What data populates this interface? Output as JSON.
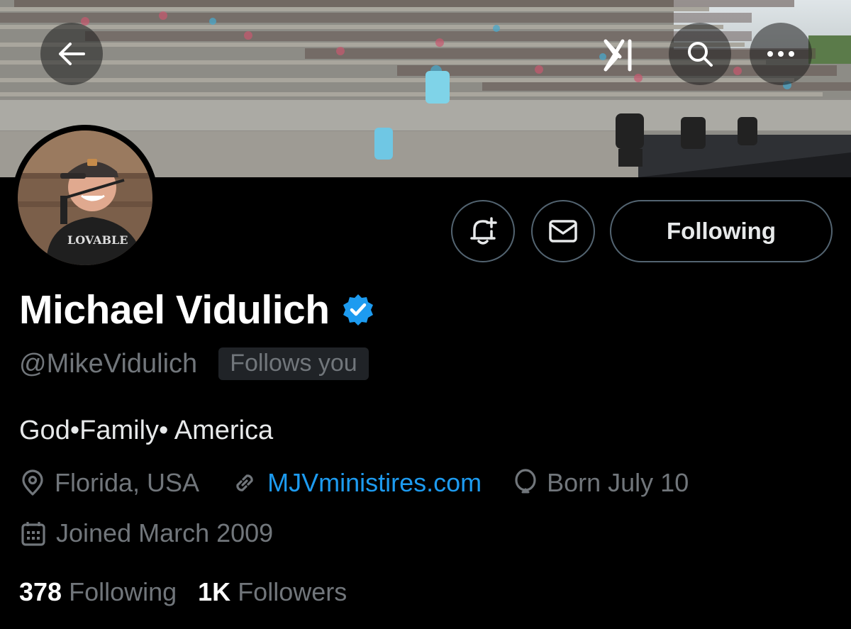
{
  "profile": {
    "display_name": "Michael Vidulich",
    "handle": "@MikeVidulich",
    "follows_you_badge": "Follows you",
    "bio": "God•Family• America",
    "location": "Florida, USA",
    "website": "MJVministires.com",
    "birthday": "Born July 10",
    "joined": "Joined March 2009",
    "verified": true
  },
  "actions": {
    "following_label": "Following",
    "notify_icon": "bell-plus-icon",
    "message_icon": "envelope-icon"
  },
  "stats": {
    "following_count": "378",
    "following_label": "Following",
    "followers_count": "1K",
    "followers_label": "Followers"
  },
  "header_icons": [
    "back-arrow-icon",
    "xai-logo-icon",
    "search-icon",
    "more-icon"
  ],
  "colors": {
    "background": "#000000",
    "accent_blue": "#1d9bf0",
    "muted_text": "#71767b",
    "border": "#536471",
    "verified_blue": "#1d9bf0"
  }
}
